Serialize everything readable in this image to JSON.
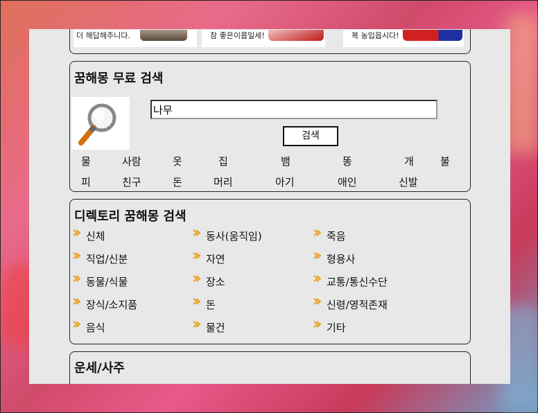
{
  "banners": [
    {
      "caption": "더 해답해주니다."
    },
    {
      "caption": "참 좋은이름일세!"
    },
    {
      "caption": "복 농입읍시다!"
    }
  ],
  "free_search": {
    "title": "꿈해몽 무료 검색",
    "input_value": "나무",
    "button_label": "검색",
    "keywords_row1": [
      "물",
      "사람",
      "옷",
      "집",
      "뱀",
      "똥",
      "개",
      "불"
    ],
    "keywords_row2": [
      "피",
      "친구",
      "돈",
      "머리",
      "아기",
      "애인",
      "신발"
    ]
  },
  "directory": {
    "title": "디렉토리 꿈해몽 검색",
    "col1": [
      "신체",
      "직업/신분",
      "동물/식물",
      "장식/소지품",
      "음식"
    ],
    "col2": [
      "동사(움직임)",
      "자연",
      "장소",
      "돈",
      "물건"
    ],
    "col3": [
      "죽음",
      "형용사",
      "교통/통신수단",
      "신령/영적존재",
      "기타"
    ]
  },
  "fortune": {
    "title": "운세/사주"
  },
  "colors": {
    "panel_bg": "#e8e8e8",
    "arrow": "#e8a020"
  }
}
